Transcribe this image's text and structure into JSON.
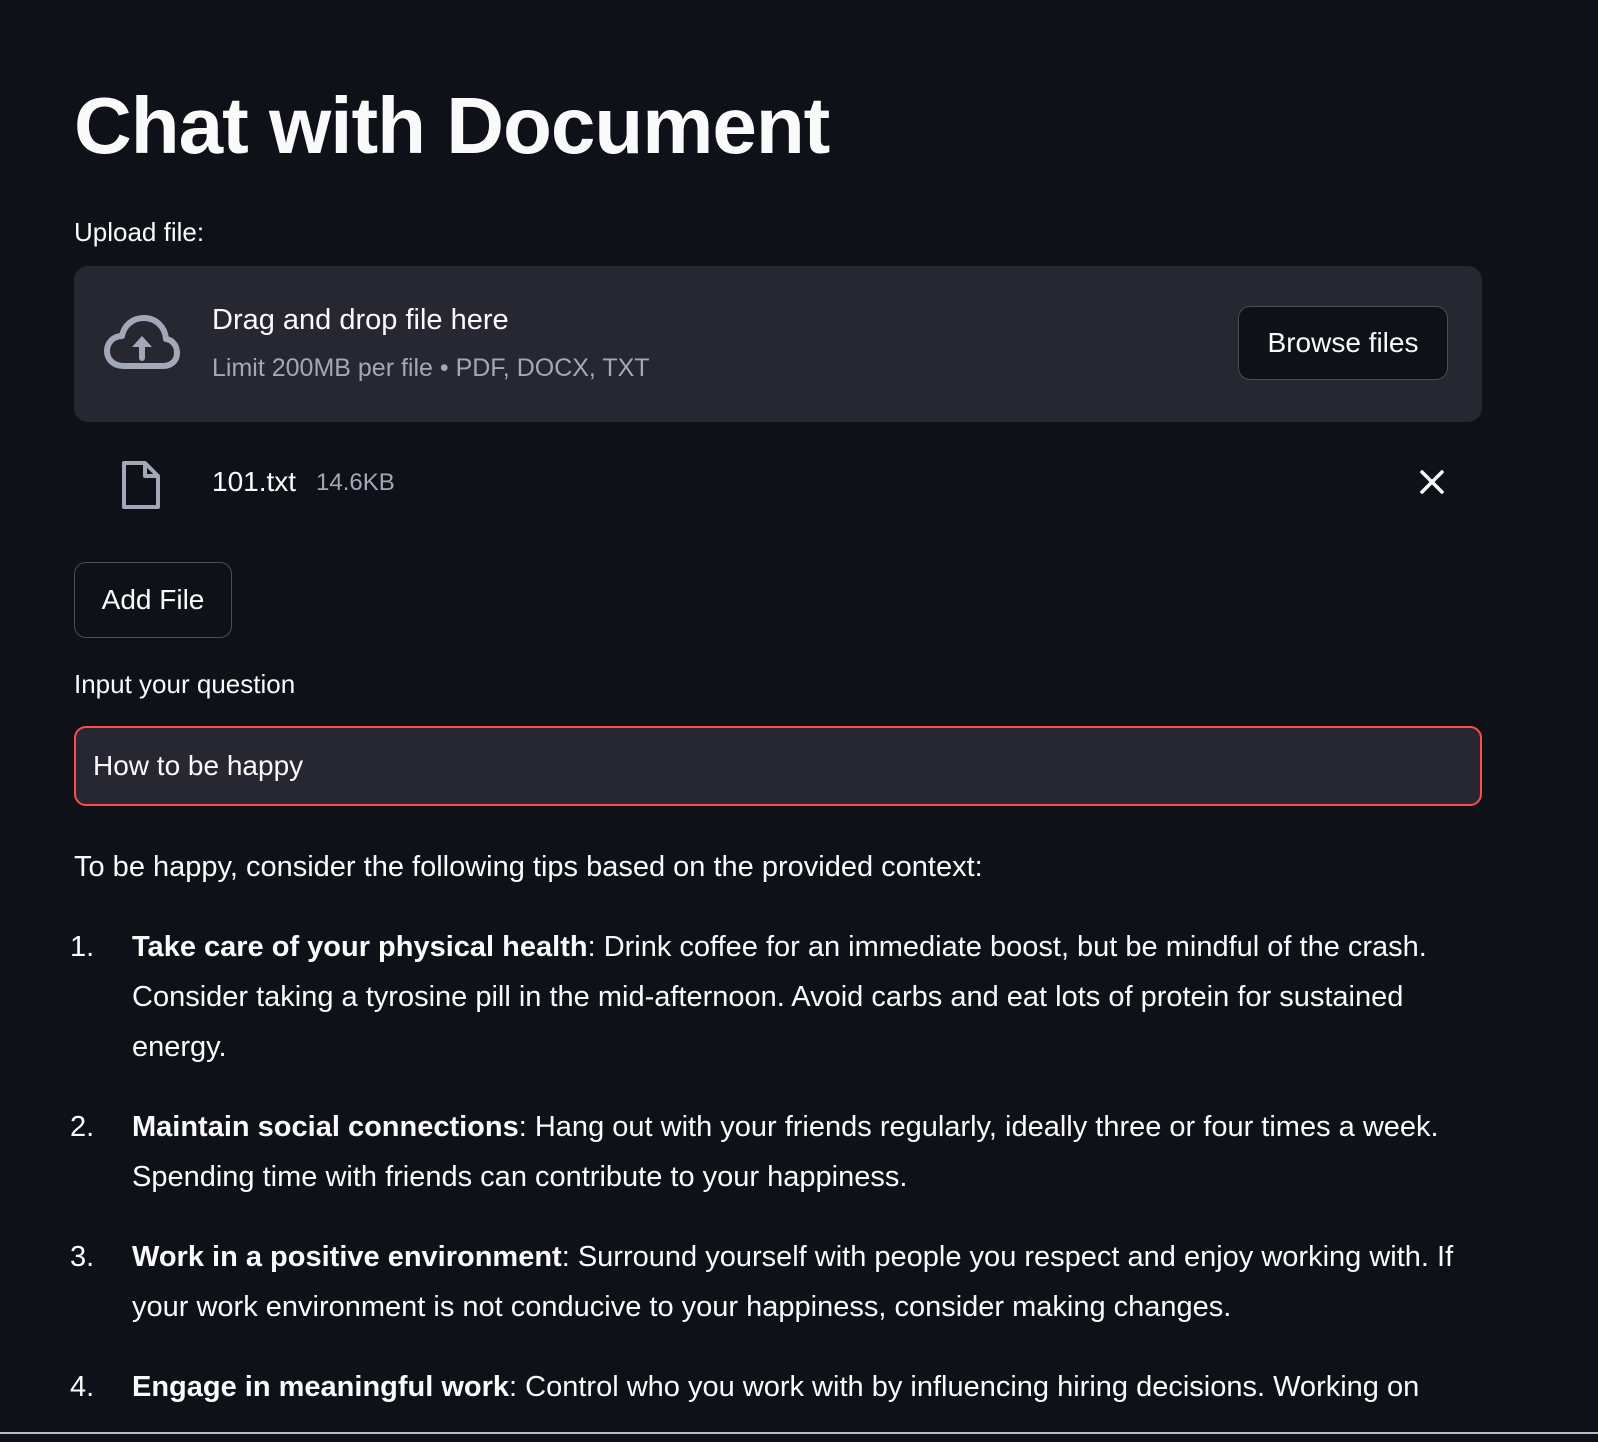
{
  "page": {
    "title": "Chat with Document"
  },
  "uploader": {
    "label": "Upload file:",
    "dropzone_title": "Drag and drop file here",
    "dropzone_limit": "Limit 200MB per file • PDF, DOCX, TXT",
    "browse_label": "Browse files",
    "icon": "cloud-upload-icon"
  },
  "uploaded_file": {
    "name": "101.txt",
    "size": "14.6KB",
    "icon": "file-icon",
    "remove_icon": "close-icon"
  },
  "add_file_label": "Add File",
  "question": {
    "label": "Input your question",
    "value": "How to be happy"
  },
  "answer": {
    "intro": "To be happy, consider the following tips based on the provided context:",
    "tips": [
      {
        "number": "1.",
        "title": "Take care of your physical health",
        "text": ": Drink coffee for an immediate boost, but be mindful of the crash. Consider taking a tyrosine pill in the mid-afternoon. Avoid carbs and eat lots of protein for sustained energy."
      },
      {
        "number": "2.",
        "title": "Maintain social connections",
        "text": ": Hang out with your friends regularly, ideally three or four times a week. Spending time with friends can contribute to your happiness."
      },
      {
        "number": "3.",
        "title": "Work in a positive environment",
        "text": ": Surround yourself with people you respect and enjoy working with. If your work environment is not conducive to your happiness, consider making changes."
      },
      {
        "number": "4.",
        "title": "Engage in meaningful work",
        "text": ": Control who you work with by influencing hiring decisions. Working on"
      }
    ]
  },
  "colors": {
    "background": "#0e1117",
    "surface": "#262730",
    "text": "#fafafa",
    "muted_text": "#a3a8b8",
    "focus_border": "#ff4b4b"
  }
}
